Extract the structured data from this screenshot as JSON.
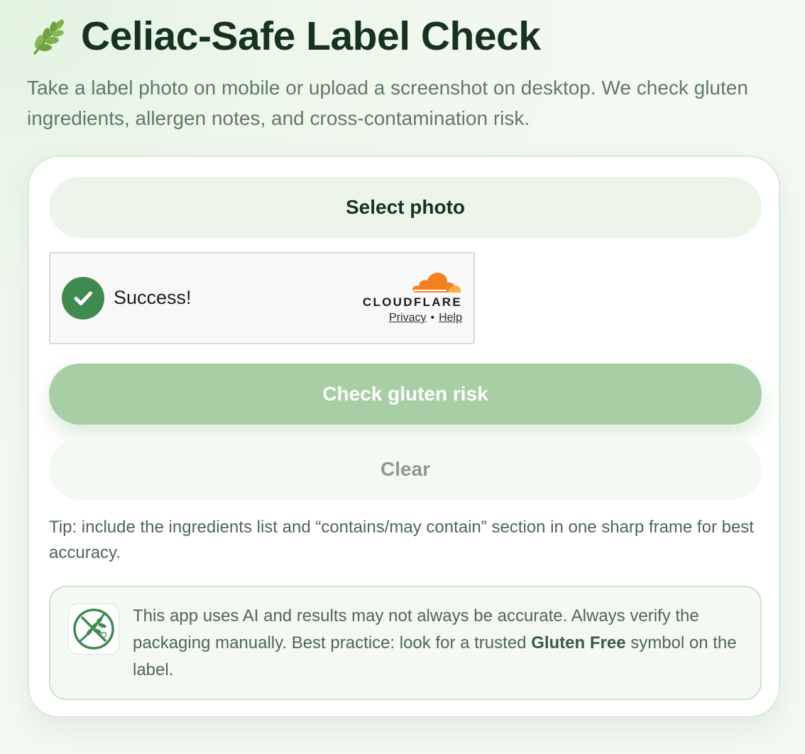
{
  "header": {
    "leaf_icon": "herb-leaf-emoji",
    "title": "Celiac-Safe Label Check",
    "subtitle": "Take a label photo on mobile or upload a screenshot on desktop. We check gluten ingredients, allergen notes, and cross-contamination risk."
  },
  "card": {
    "select_photo_label": "Select photo",
    "turnstile": {
      "status": "Success!",
      "brand": "CLOUDFLARE",
      "privacy_link": "Privacy",
      "separator": "•",
      "help_link": "Help"
    },
    "check_button_label": "Check gluten risk",
    "clear_button_label": "Clear",
    "tip": "Tip: include the ingredients list and “contains/may contain” section in one sharp frame for best accuracy.",
    "notice": {
      "icon": "gluten-free-symbol",
      "text_before": "This app uses AI and results may not always be accurate. Always verify the packaging manually. Best practice: look for a trusted ",
      "text_strong": "Gluten Free",
      "text_after": " symbol on the label."
    }
  },
  "colors": {
    "primary_button": "#a8cea6",
    "success_green": "#3f8a50",
    "cloudflare_orange": "#f38020",
    "text_dark": "#17331f",
    "text_muted": "#5f7a69"
  }
}
